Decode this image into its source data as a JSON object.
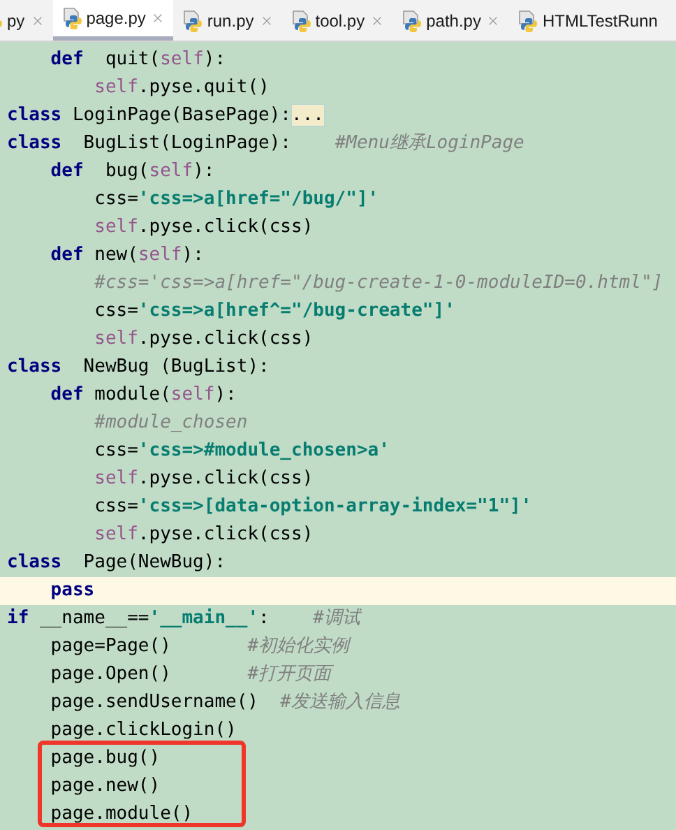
{
  "tabs": [
    {
      "label": "py",
      "selected": false,
      "closable": true
    },
    {
      "label": "page.py",
      "selected": true,
      "closable": true
    },
    {
      "label": "run.py",
      "selected": false,
      "closable": true
    },
    {
      "label": "tool.py",
      "selected": false,
      "closable": true
    },
    {
      "label": "path.py",
      "selected": false,
      "closable": true
    },
    {
      "label": "HTMLTestRunn",
      "selected": false,
      "closable": false
    }
  ],
  "lines": [
    {
      "current": false,
      "boxed": false,
      "tokens": [
        {
          "kind": "keyword",
          "text": "    def"
        },
        {
          "kind": "plain",
          "text": "  quit("
        },
        {
          "kind": "self",
          "text": "self"
        },
        {
          "kind": "plain",
          "text": "):"
        }
      ]
    },
    {
      "current": false,
      "boxed": false,
      "tokens": [
        {
          "kind": "self",
          "text": "        self"
        },
        {
          "kind": "plain",
          "text": ".pyse.quit()"
        }
      ]
    },
    {
      "current": false,
      "boxed": false,
      "tokens": [
        {
          "kind": "keyword",
          "text": "class"
        },
        {
          "kind": "plain",
          "text": " LoginPage(BasePage):"
        },
        {
          "kind": "fold",
          "text": "..."
        }
      ]
    },
    {
      "current": false,
      "boxed": false,
      "tokens": [
        {
          "kind": "keyword",
          "text": "class"
        },
        {
          "kind": "plain",
          "text": "  BugList(LoginPage):    "
        },
        {
          "kind": "comment",
          "text": "#Menu继承LoginPage"
        }
      ]
    },
    {
      "current": false,
      "boxed": false,
      "tokens": [
        {
          "kind": "keyword",
          "text": "    def"
        },
        {
          "kind": "plain",
          "text": "  bug("
        },
        {
          "kind": "self",
          "text": "self"
        },
        {
          "kind": "plain",
          "text": "):"
        }
      ]
    },
    {
      "current": false,
      "boxed": false,
      "tokens": [
        {
          "kind": "plain",
          "text": "        css="
        },
        {
          "kind": "string",
          "text": "'css=>a[href=\"/bug/\"]'"
        }
      ]
    },
    {
      "current": false,
      "boxed": false,
      "tokens": [
        {
          "kind": "self",
          "text": "        self"
        },
        {
          "kind": "plain",
          "text": ".pyse.click(css)"
        }
      ]
    },
    {
      "current": false,
      "boxed": false,
      "tokens": [
        {
          "kind": "keyword",
          "text": "    def"
        },
        {
          "kind": "plain",
          "text": " new("
        },
        {
          "kind": "self",
          "text": "self"
        },
        {
          "kind": "plain",
          "text": "):"
        }
      ]
    },
    {
      "current": false,
      "boxed": false,
      "tokens": [
        {
          "kind": "comment",
          "text": "        #css='css=>a[href=\"/bug-create-1-0-moduleID=0.html\"]"
        }
      ]
    },
    {
      "current": false,
      "boxed": false,
      "tokens": [
        {
          "kind": "plain",
          "text": "        css="
        },
        {
          "kind": "string",
          "text": "'css=>a[href^=\"/bug-create\"]'"
        }
      ]
    },
    {
      "current": false,
      "boxed": false,
      "tokens": [
        {
          "kind": "self",
          "text": "        self"
        },
        {
          "kind": "plain",
          "text": ".pyse.click(css)"
        }
      ]
    },
    {
      "current": false,
      "boxed": false,
      "tokens": [
        {
          "kind": "keyword",
          "text": "class"
        },
        {
          "kind": "plain",
          "text": "  NewBug (BugList):"
        }
      ]
    },
    {
      "current": false,
      "boxed": false,
      "tokens": [
        {
          "kind": "keyword",
          "text": "    def"
        },
        {
          "kind": "plain",
          "text": " module("
        },
        {
          "kind": "self",
          "text": "self"
        },
        {
          "kind": "plain",
          "text": "):"
        }
      ]
    },
    {
      "current": false,
      "boxed": false,
      "tokens": [
        {
          "kind": "comment",
          "text": "        #module_chosen"
        }
      ]
    },
    {
      "current": false,
      "boxed": false,
      "tokens": [
        {
          "kind": "plain",
          "text": "        css="
        },
        {
          "kind": "string",
          "text": "'css=>#module_chosen>a'"
        }
      ]
    },
    {
      "current": false,
      "boxed": false,
      "tokens": [
        {
          "kind": "self",
          "text": "        self"
        },
        {
          "kind": "plain",
          "text": ".pyse.click(css)"
        }
      ]
    },
    {
      "current": false,
      "boxed": false,
      "tokens": [
        {
          "kind": "plain",
          "text": "        css="
        },
        {
          "kind": "string",
          "text": "'css=>[data-option-array-index=\"1\"]'"
        }
      ]
    },
    {
      "current": false,
      "boxed": false,
      "tokens": [
        {
          "kind": "self",
          "text": "        self"
        },
        {
          "kind": "plain",
          "text": ".pyse.click(css)"
        }
      ]
    },
    {
      "current": false,
      "boxed": false,
      "tokens": [
        {
          "kind": "keyword",
          "text": "class"
        },
        {
          "kind": "plain",
          "text": "  Page(NewBug):"
        }
      ]
    },
    {
      "current": true,
      "boxed": false,
      "tokens": [
        {
          "kind": "keyword",
          "text": "    pass"
        }
      ]
    },
    {
      "current": false,
      "boxed": false,
      "tokens": [
        {
          "kind": "keyword",
          "text": "if"
        },
        {
          "kind": "plain",
          "text": " __name__=="
        },
        {
          "kind": "string",
          "text": "'__main__'"
        },
        {
          "kind": "plain",
          "text": ":    "
        },
        {
          "kind": "comment",
          "text": "#调试"
        }
      ]
    },
    {
      "current": false,
      "boxed": false,
      "tokens": [
        {
          "kind": "plain",
          "text": "    page=Page()       "
        },
        {
          "kind": "comment",
          "text": "#初始化实例"
        }
      ]
    },
    {
      "current": false,
      "boxed": false,
      "tokens": [
        {
          "kind": "plain",
          "text": "    page.Open()       "
        },
        {
          "kind": "comment",
          "text": "#打开页面"
        }
      ]
    },
    {
      "current": false,
      "boxed": false,
      "tokens": [
        {
          "kind": "plain",
          "text": "    page.sendUsername()  "
        },
        {
          "kind": "comment",
          "text": "#发送输入信息"
        }
      ]
    },
    {
      "current": false,
      "boxed": false,
      "tokens": [
        {
          "kind": "plain",
          "text": "    page.clickLogin()"
        }
      ]
    },
    {
      "current": false,
      "boxed": true,
      "tokens": [
        {
          "kind": "plain",
          "text": "    page.bug()"
        }
      ]
    },
    {
      "current": false,
      "boxed": true,
      "tokens": [
        {
          "kind": "plain",
          "text": "    page.new()"
        }
      ]
    },
    {
      "current": false,
      "boxed": true,
      "tokens": [
        {
          "kind": "plain",
          "text": "    page.module()"
        }
      ]
    }
  ]
}
